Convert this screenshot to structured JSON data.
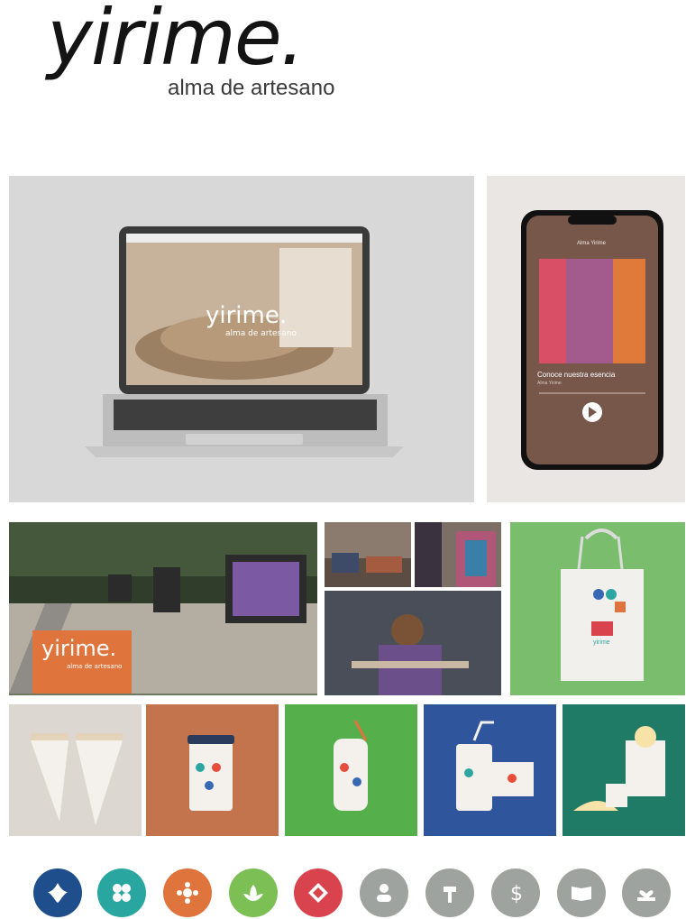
{
  "brand": {
    "name": "yirime.",
    "tagline": "alma de artesano",
    "accent_orange": "#e0743d",
    "accent_green": "#79bd6d"
  },
  "laptop_screen": {
    "logo": "yirime.",
    "tagline": "alma de artesano"
  },
  "phone_screen": {
    "header": "Alma Yirime",
    "track_title": "Conoce nuestra esencia",
    "artist": "Alma Yirime"
  },
  "street_sign": {
    "logo": "yirime.",
    "tagline": "alma de artesano"
  },
  "tote": {
    "logo_text": "yirime"
  },
  "icons": [
    {
      "name": "splash-icon",
      "color": "#1f4e8c"
    },
    {
      "name": "flower-pattern-icon",
      "color": "#2aa6a1"
    },
    {
      "name": "sun-flower-icon",
      "color": "#e0743d"
    },
    {
      "name": "lotus-icon",
      "color": "#7cbf55"
    },
    {
      "name": "diamond-icon",
      "color": "#d9434e"
    },
    {
      "name": "user-icon",
      "color": "#9ea3a0"
    },
    {
      "name": "hammer-icon",
      "color": "#9ea3a0"
    },
    {
      "name": "dollar-icon",
      "color": "#9ea3a0"
    },
    {
      "name": "book-icon",
      "color": "#9ea3a0"
    },
    {
      "name": "hands-heart-icon",
      "color": "#9ea3a0"
    }
  ]
}
